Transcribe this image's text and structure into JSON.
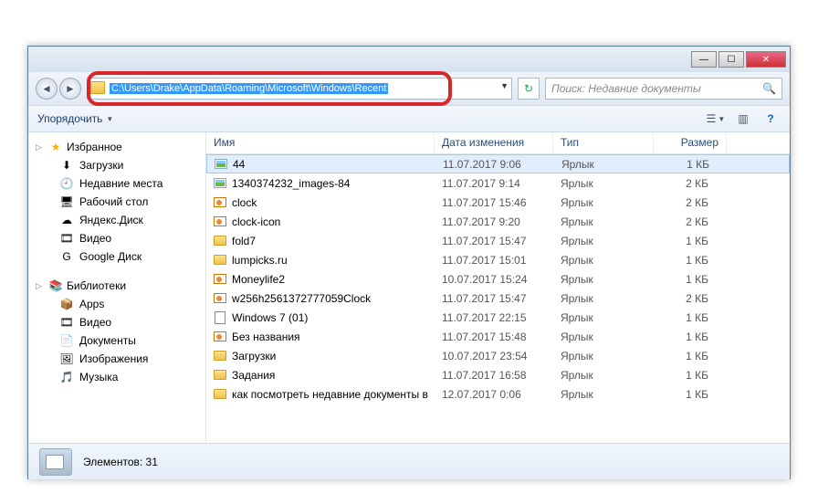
{
  "titlebar": {
    "min": "—",
    "max": "☐",
    "close": "✕"
  },
  "nav": {
    "back": "◄",
    "forward": "►"
  },
  "address": {
    "path": "C:\\Users\\Drake\\AppData\\Roaming\\Microsoft\\Windows\\Recent"
  },
  "refresh": {
    "glyph": "↻"
  },
  "search": {
    "placeholder": "Поиск: Недавние документы",
    "icon": "🔍"
  },
  "toolbar": {
    "organize": "Упорядочить",
    "view_icon": "☰",
    "preview_icon": "▥",
    "help_icon": "?"
  },
  "sidebar": {
    "favorites": {
      "label": "Избранное",
      "items": [
        {
          "icon": "⬇",
          "label": "Загрузки"
        },
        {
          "icon": "🕘",
          "label": "Недавние места"
        },
        {
          "icon": "🖥",
          "label": "Рабочий стол"
        },
        {
          "icon": "☁",
          "label": "Яндекс.Диск"
        },
        {
          "icon": "🎞",
          "label": "Видео"
        },
        {
          "icon": "G",
          "label": "Google Диск"
        }
      ]
    },
    "libraries": {
      "label": "Библиотеки",
      "items": [
        {
          "icon": "📦",
          "label": "Apps"
        },
        {
          "icon": "🎞",
          "label": "Видео"
        },
        {
          "icon": "📄",
          "label": "Документы"
        },
        {
          "icon": "🖼",
          "label": "Изображения"
        },
        {
          "icon": "🎵",
          "label": "Музыка"
        }
      ]
    }
  },
  "columns": {
    "name": "Имя",
    "date": "Дата изменения",
    "type": "Тип",
    "size": "Размер"
  },
  "files": [
    {
      "icon": "img",
      "name": "44",
      "date": "11.07.2017 9:06",
      "type": "Ярлык",
      "size": "1 КБ",
      "selected": true
    },
    {
      "icon": "img",
      "name": "1340374232_images-84",
      "date": "11.07.2017 9:14",
      "type": "Ярлык",
      "size": "2 КБ"
    },
    {
      "icon": "orange",
      "name": "clock",
      "date": "11.07.2017 15:46",
      "type": "Ярлык",
      "size": "2 КБ"
    },
    {
      "icon": "orange",
      "name": "clock-icon",
      "date": "11.07.2017 9:20",
      "type": "Ярлык",
      "size": "2 КБ"
    },
    {
      "icon": "folder",
      "name": "fold7",
      "date": "11.07.2017 15:47",
      "type": "Ярлык",
      "size": "1 КБ"
    },
    {
      "icon": "folder",
      "name": "lumpicks.ru",
      "date": "11.07.2017 15:01",
      "type": "Ярлык",
      "size": "1 КБ"
    },
    {
      "icon": "orange",
      "name": "Moneylife2",
      "date": "10.07.2017 15:24",
      "type": "Ярлык",
      "size": "1 КБ"
    },
    {
      "icon": "orange",
      "name": "w256h2561372777059Clock",
      "date": "11.07.2017 15:47",
      "type": "Ярлык",
      "size": "2 КБ"
    },
    {
      "icon": "doc",
      "name": "Windows 7 (01)",
      "date": "11.07.2017 22:15",
      "type": "Ярлык",
      "size": "1 КБ"
    },
    {
      "icon": "orange",
      "name": "Без названия",
      "date": "11.07.2017 15:48",
      "type": "Ярлык",
      "size": "1 КБ"
    },
    {
      "icon": "folder",
      "name": "Загрузки",
      "date": "10.07.2017 23:54",
      "type": "Ярлык",
      "size": "1 КБ"
    },
    {
      "icon": "folder",
      "name": "Задания",
      "date": "11.07.2017 16:58",
      "type": "Ярлык",
      "size": "1 КБ"
    },
    {
      "icon": "folder",
      "name": "как посмотреть недавние документы в",
      "date": "12.07.2017 0:06",
      "type": "Ярлык",
      "size": "1 КБ"
    }
  ],
  "status": {
    "count_label": "Элементов: 31"
  }
}
